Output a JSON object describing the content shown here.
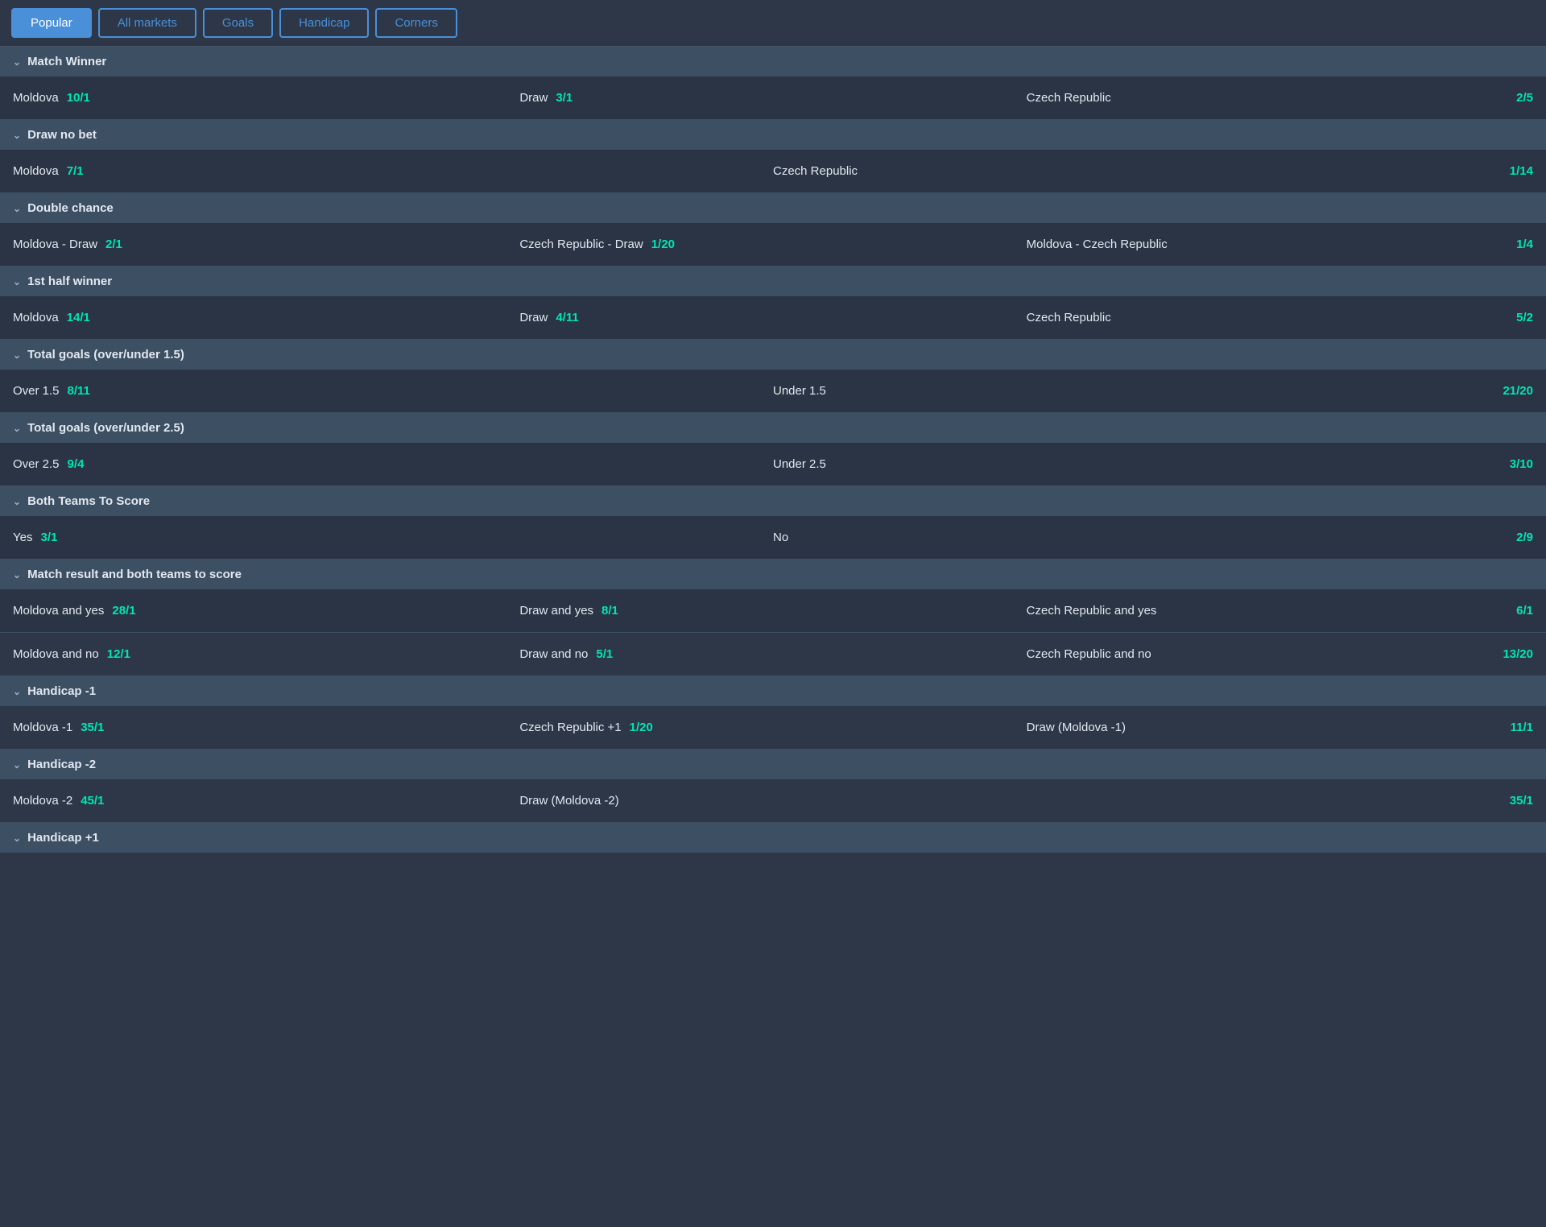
{
  "tabs": [
    {
      "id": "popular",
      "label": "Popular",
      "active": true
    },
    {
      "id": "all-markets",
      "label": "All markets",
      "active": false
    },
    {
      "id": "goals",
      "label": "Goals",
      "active": false
    },
    {
      "id": "handicap",
      "label": "Handicap",
      "active": false
    },
    {
      "id": "corners",
      "label": "Corners",
      "active": false
    }
  ],
  "sections": [
    {
      "id": "match-winner",
      "title": "Match Winner",
      "rows": [
        {
          "type": "three-col",
          "left": {
            "label": "Moldova",
            "odds": "10/1"
          },
          "center": {
            "label": "Draw",
            "odds": "3/1"
          },
          "right": {
            "label": "Czech Republic",
            "odds": "2/5"
          }
        }
      ]
    },
    {
      "id": "draw-no-bet",
      "title": "Draw no bet",
      "rows": [
        {
          "type": "two-col",
          "left": {
            "label": "Moldova",
            "odds": "7/1"
          },
          "right": {
            "label": "Czech Republic",
            "odds": "1/14"
          }
        }
      ]
    },
    {
      "id": "double-chance",
      "title": "Double chance",
      "rows": [
        {
          "type": "three-col",
          "left": {
            "label": "Moldova - Draw",
            "odds": "2/1"
          },
          "center": {
            "label": "Czech Republic - Draw",
            "odds": "1/20"
          },
          "right": {
            "label": "Moldova - Czech Republic",
            "odds": "1/4"
          }
        }
      ]
    },
    {
      "id": "1st-half-winner",
      "title": "1st half winner",
      "rows": [
        {
          "type": "three-col",
          "left": {
            "label": "Moldova",
            "odds": "14/1"
          },
          "center": {
            "label": "Draw",
            "odds": "4/11"
          },
          "right": {
            "label": "Czech Republic",
            "odds": "5/2"
          }
        }
      ]
    },
    {
      "id": "total-goals-1.5",
      "title": "Total goals (over/under 1.5)",
      "rows": [
        {
          "type": "two-col",
          "left": {
            "label": "Over 1.5",
            "odds": "8/11"
          },
          "right": {
            "label": "Under 1.5",
            "odds": "21/20"
          }
        }
      ]
    },
    {
      "id": "total-goals-2.5",
      "title": "Total goals (over/under 2.5)",
      "rows": [
        {
          "type": "two-col",
          "left": {
            "label": "Over 2.5",
            "odds": "9/4"
          },
          "right": {
            "label": "Under 2.5",
            "odds": "3/10"
          }
        }
      ]
    },
    {
      "id": "both-teams-to-score",
      "title": "Both Teams To Score",
      "rows": [
        {
          "type": "two-col",
          "left": {
            "label": "Yes",
            "odds": "3/1"
          },
          "right": {
            "label": "No",
            "odds": "2/9"
          }
        }
      ]
    },
    {
      "id": "match-result-both-teams",
      "title": "Match result and both teams to score",
      "rows": [
        {
          "type": "three-col",
          "left": {
            "label": "Moldova and yes",
            "odds": "28/1"
          },
          "center": {
            "label": "Draw and yes",
            "odds": "8/1"
          },
          "right": {
            "label": "Czech Republic and yes",
            "odds": "6/1"
          }
        },
        {
          "type": "three-col",
          "left": {
            "label": "Moldova and no",
            "odds": "12/1"
          },
          "center": {
            "label": "Draw and no",
            "odds": "5/1"
          },
          "right": {
            "label": "Czech Republic and no",
            "odds": "13/20"
          }
        }
      ]
    },
    {
      "id": "handicap-minus-1",
      "title": "Handicap -1",
      "rows": [
        {
          "type": "three-col",
          "left": {
            "label": "Moldova -1",
            "odds": "35/1"
          },
          "center": {
            "label": "Czech Republic +1",
            "odds": "1/20"
          },
          "right": {
            "label": "Draw (Moldova -1)",
            "odds": "11/1"
          }
        }
      ]
    },
    {
      "id": "handicap-minus-2",
      "title": "Handicap -2",
      "rows": [
        {
          "type": "three-col",
          "left": {
            "label": "Moldova -2",
            "odds": "45/1"
          },
          "center": {
            "label": "Draw (Moldova -2)",
            "odds": ""
          },
          "right": {
            "label": "",
            "odds": "35/1"
          }
        }
      ]
    },
    {
      "id": "handicap-plus-1",
      "title": "Handicap +1",
      "rows": []
    }
  ]
}
